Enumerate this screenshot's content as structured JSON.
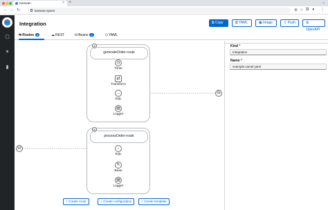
{
  "browser": {
    "tab_title": "Karavan",
    "tab_close": "×",
    "new_tab": "+",
    "url": "karavan.space"
  },
  "header": {
    "title": "Integration",
    "buttons": {
      "copy": "Copy",
      "yaml": "YAML",
      "image": "Image",
      "push": "Push",
      "openapi": "OpenAPI"
    }
  },
  "tabs": {
    "routes": "Routes",
    "routes_count": "2",
    "rest": "REST",
    "beans": "Beans",
    "beans_count": "0",
    "yaml": "YAML"
  },
  "routes": [
    {
      "name": "generateOrder-route",
      "collapse": "A",
      "steps": [
        "Timer",
        "Transform",
        "SQL",
        "Logger"
      ]
    },
    {
      "name": "processOrder-route",
      "collapse": "A",
      "steps": [
        "SQL",
        "Bean",
        "Logger"
      ]
    }
  ],
  "footer": {
    "create_route": "+ Create route",
    "create_configuration": "+ Create configuration",
    "create_template": "+ Create template"
  },
  "properties": {
    "kind_label": "Kind",
    "kind_required": "*",
    "kind_value": "Integration",
    "name_label": "Name",
    "name_required": "*",
    "name_value": "example.camel.yaml"
  },
  "colors": {
    "primary": "#0066cc",
    "sidebar": "#212427",
    "border": "#b8bbbe"
  }
}
